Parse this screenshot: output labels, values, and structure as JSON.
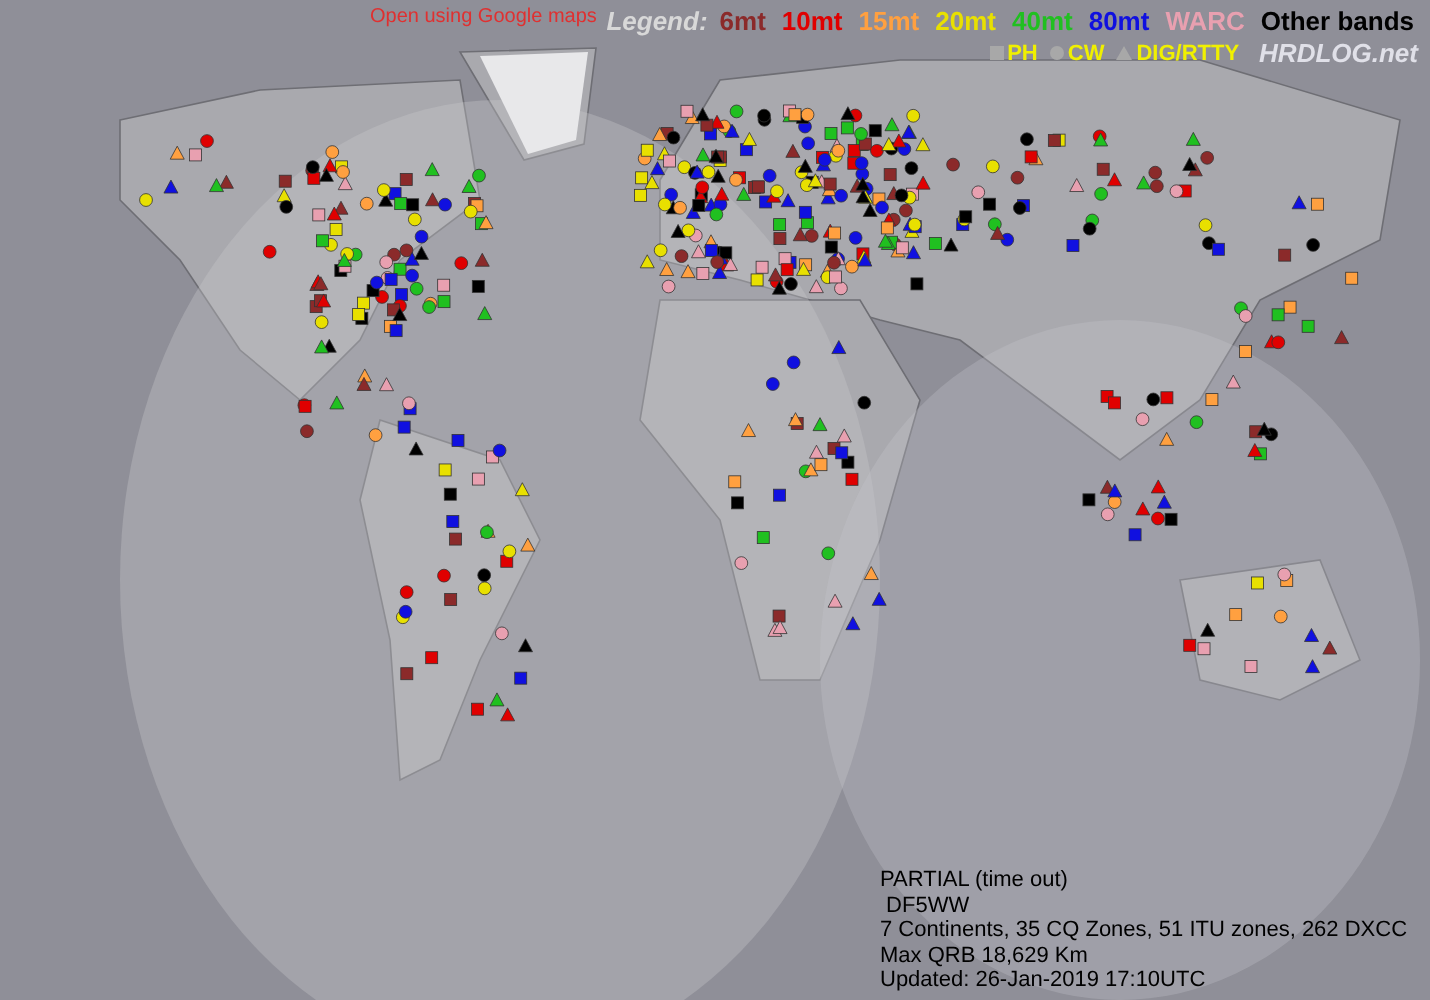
{
  "map_link": "Open using Google maps",
  "legend": {
    "title": "Legend:",
    "bands": [
      {
        "label": "6mt",
        "color": "#8b2a2a"
      },
      {
        "label": "10mt",
        "color": "#e00000"
      },
      {
        "label": "15mt",
        "color": "#ffa040"
      },
      {
        "label": "20mt",
        "color": "#e8e000"
      },
      {
        "label": "40mt",
        "color": "#20c020"
      },
      {
        "label": "80mt",
        "color": "#1010e0"
      },
      {
        "label": "WARC",
        "color": "#e8a0b0"
      },
      {
        "label": "Other bands",
        "color": "#000000"
      }
    ],
    "modes": [
      {
        "label": "PH",
        "kind": "square"
      },
      {
        "label": "CW",
        "kind": "circle"
      },
      {
        "label": "DIG/RTTY",
        "kind": "triangle"
      }
    ]
  },
  "logo": "HRDLOG.net",
  "info": [
    "PARTIAL (time out)",
    " DF5WW",
    "7 Continents, 35 CQ Zones, 51 ITU zones, 262 DXCC",
    "Max QRB 18,629 Km",
    "Updated: 26-Jan-2019 17:10UTC"
  ]
}
